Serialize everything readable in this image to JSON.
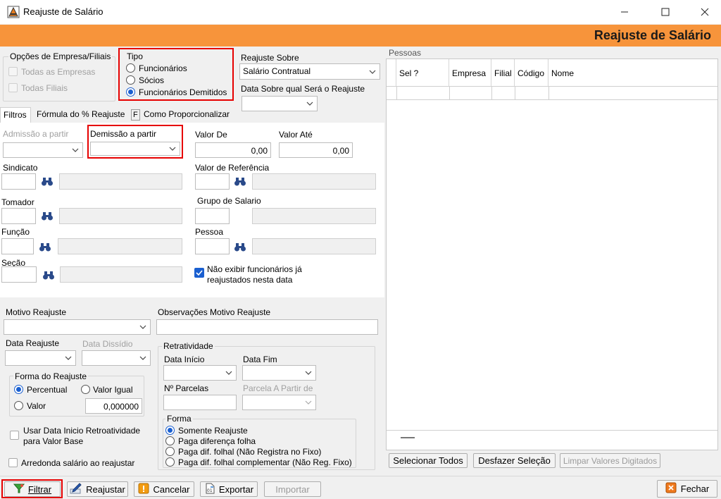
{
  "window": {
    "title": "Reajuste de Salário",
    "banner": "Reajuste de Salário"
  },
  "empresa": {
    "group_title": "Opções de Empresa/Filiais",
    "todas_empresas": "Todas as Empresas",
    "todas_filiais": "Todas Filiais"
  },
  "tipo": {
    "title": "Tipo",
    "funcionarios": "Funcionários",
    "socios": "Sócios",
    "demitidos": "Funcionários Demitidos",
    "selected": "Funcionários Demitidos"
  },
  "reajuste_sobre": {
    "label": "Reajuste Sobre",
    "value": "Salário Contratual",
    "data_label": "Data Sobre qual Será o Reajuste"
  },
  "tabs": {
    "filtros": "Filtros",
    "formula": "Fórmula do % Reajuste",
    "f": "F",
    "proporcionalizar": "Como Proporcionalizar"
  },
  "filtros": {
    "admissao": "Admissão a partir",
    "demissao": "Demissão a partir",
    "valor_de": "Valor  De",
    "valor_de_value": "0,00",
    "valor_ate": "Valor Até",
    "valor_ate_value": "0,00",
    "sindicato": "Sindicato",
    "valor_referencia": "Valor de Referência",
    "tomador": "Tomador",
    "grupo_salario": "Grupo de Salario",
    "funcao": "Função",
    "pessoa": "Pessoa",
    "secao": "Seção",
    "nao_exibir": "Não exibir funcionários já",
    "nao_exibir_2": "reajustados nesta data"
  },
  "motivo": {
    "label": "Motivo Reajuste",
    "obs_label": "Observações Motivo Reajuste"
  },
  "datas": {
    "data_reajuste": "Data Reajuste",
    "data_dissidio": "Data Dissídio"
  },
  "forma_reajuste": {
    "title": "Forma do Reajuste",
    "percentual": "Percentual",
    "valor_igual": "Valor Igual",
    "valor": "Valor",
    "valor_value": "0,000000"
  },
  "opcoes": {
    "usar_data": "Usar Data Inicio Retroatividade",
    "usar_data_2": "para Valor Base",
    "arredonda": "Arredonda salário ao reajustar"
  },
  "retro": {
    "title": "Retratividade",
    "data_inicio": "Data Início",
    "data_fim": "Data Fim",
    "parcelas": "Nº Parcelas",
    "parcela_partir": "Parcela A Partir de",
    "forma_title": "Forma",
    "forma_opts": [
      "Somente Reajuste",
      "Paga diferença folha",
      "Paga dif. folhal (Não Registra no Fixo)",
      "Paga dif. folhal complementar (Não Reg. Fixo)"
    ]
  },
  "pessoas": {
    "title": "Pessoas",
    "columns": [
      "Sel ?",
      "Empresa",
      "Filial",
      "Código",
      "Nome"
    ],
    "selecionar_todos": "Selecionar Todos",
    "desfazer": "Desfazer Seleção",
    "limpar": "Limpar Valores Digitados"
  },
  "toolbar": {
    "filtrar": "Filtrar",
    "reajustar": "Reajustar",
    "cancelar": "Cancelar",
    "exportar": "Exportar",
    "importar": "Importar",
    "fechar": "Fechar"
  },
  "colors": {
    "banner": "#f7943b",
    "accent": "#1a5fd0",
    "highlight": "#e60000"
  }
}
